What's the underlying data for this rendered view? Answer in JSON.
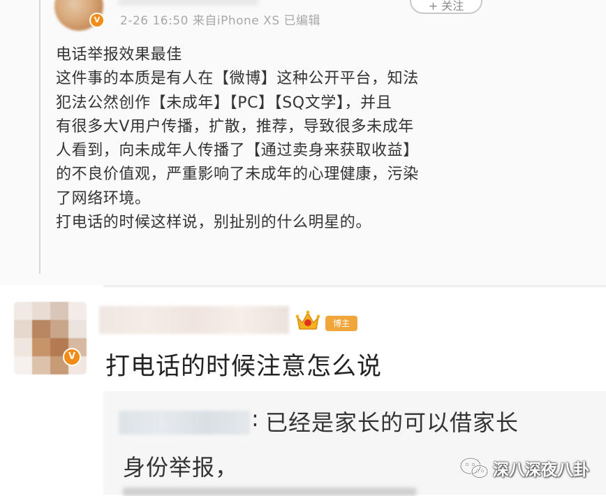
{
  "top_post": {
    "meta": "2-26 16:50  来自iPhone XS  已编辑",
    "follow_label": "+ 关注",
    "verified_badge": "V",
    "body_lines": [
      "电话举报效果最佳",
      "这件事的本质是有人在【微博】这种公开平台，知法",
      "犯法公然创作【未成年】【PC】【SQ文学】，并且",
      "有很多大V用户传播，扩散，推荐，导致很多未成年",
      "人看到，向未成年人传播了【通过卖身来获取收益】",
      "的不良价值观，严重影响了未成年的心理健康，污染",
      "了网络环境。",
      "打电话的时候这样说，别扯别的什么明星的。"
    ]
  },
  "comment": {
    "verified_badge": "V",
    "user_badge": "博主",
    "text": "打电话的时候注意怎么说",
    "reply": {
      "colon": ":",
      "line1": "已经是家长的可以借家长",
      "line2": "身份举报，"
    }
  },
  "watermark": {
    "text": "深八深夜八卦"
  },
  "colors": {
    "verified_orange": "#f28c16",
    "badge_orange": "#f0a63a",
    "text": "#333333",
    "meta_gray": "#a8a8a8"
  }
}
